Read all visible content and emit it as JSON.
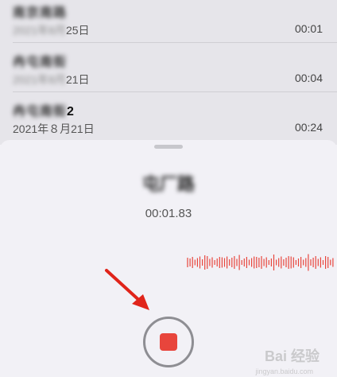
{
  "recordings": [
    {
      "name_blur": "南京南路",
      "date_blur": "2021年8月",
      "date_tail": "25日",
      "duration": "00:01"
    },
    {
      "name_blur": "冉屯南街",
      "date_blur": "2021年8月",
      "date_tail": "21日",
      "duration": "00:04"
    },
    {
      "name_blur": "冉屯南街",
      "name_tail": "2",
      "date": "2021年８月21日",
      "duration": "00:24"
    }
  ],
  "recorder": {
    "title": "屯厂路",
    "elapsed": "00:01.83"
  },
  "watermark": {
    "brand": "Bai 经验",
    "sub": "jingyan.baidu.com"
  },
  "colors": {
    "stop": "#e8453c",
    "waveform": "#e8453c",
    "arrow": "#e0241a"
  }
}
